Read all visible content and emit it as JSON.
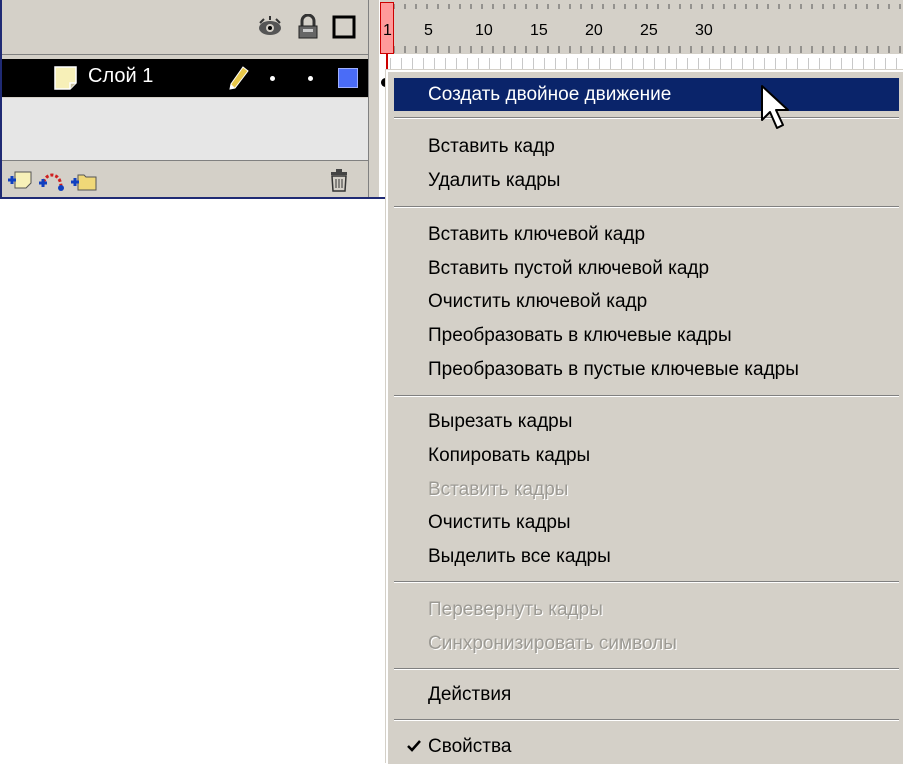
{
  "timeline": {
    "layer": {
      "name": "Слой 1",
      "color": "#4a6cf7"
    },
    "ruler_numbers": [
      "1",
      "5",
      "10",
      "15",
      "20",
      "25",
      "30"
    ],
    "header_icons": [
      "eye-icon",
      "lock-icon",
      "outline-icon"
    ],
    "footer_icons": [
      "insert-layer-icon",
      "add-motion-guide-icon",
      "insert-layer-folder-icon",
      "trash-icon"
    ]
  },
  "menu": {
    "items": [
      {
        "label": "Создать двойное движение",
        "state": "highlighted"
      },
      {
        "label": "Вставить кадр"
      },
      {
        "label": "Удалить кадры"
      },
      {
        "label": "Вставить ключевой кадр"
      },
      {
        "label": "Вставить пустой ключевой кадр"
      },
      {
        "label": "Очистить ключевой кадр"
      },
      {
        "label": "Преобразовать в ключевые кадры"
      },
      {
        "label": "Преобразовать в пустые ключевые кадры"
      },
      {
        "label": "Вырезать кадры"
      },
      {
        "label": "Копировать кадры"
      },
      {
        "label": "Вставить кадры",
        "state": "disabled"
      },
      {
        "label": "Очистить кадры"
      },
      {
        "label": "Выделить все кадры"
      },
      {
        "label": "Перевернуть кадры",
        "state": "disabled"
      },
      {
        "label": "Синхронизировать символы",
        "state": "disabled"
      },
      {
        "label": "Действия"
      },
      {
        "label": "Свойства",
        "checked": true
      }
    ]
  },
  "colors": {
    "menu_bg": "#d4d0c8",
    "highlight": "#0a246a",
    "disabled_text": "#9c9a94",
    "playhead": "#cc0000"
  }
}
